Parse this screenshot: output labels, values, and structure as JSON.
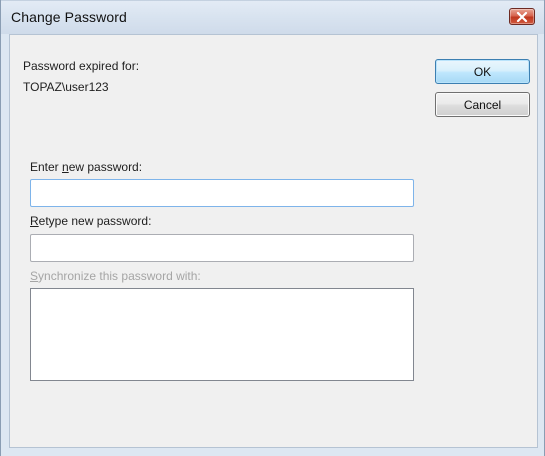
{
  "window": {
    "title": "Change Password",
    "close_icon": "close-icon"
  },
  "info": {
    "expired_label": "Password expired for:",
    "account": "TOPAZ\\user123"
  },
  "buttons": {
    "ok": "OK",
    "cancel": "Cancel"
  },
  "fields": {
    "new_password_label_pre": "Enter ",
    "new_password_label_key": "n",
    "new_password_label_post": "ew password:",
    "new_password_value": "",
    "retype_label_key": "R",
    "retype_label_post": "etype new password:",
    "retype_value": "",
    "sync_label_key": "S",
    "sync_label_post": "ynchronize this password with:",
    "sync_items": []
  },
  "colors": {
    "client_bg": "#f0f0f0",
    "frame_bg": "#dde7f2",
    "close_red": "#c0381f",
    "ok_border": "#3c7fb1",
    "disabled_text": "#a5a5a5"
  }
}
